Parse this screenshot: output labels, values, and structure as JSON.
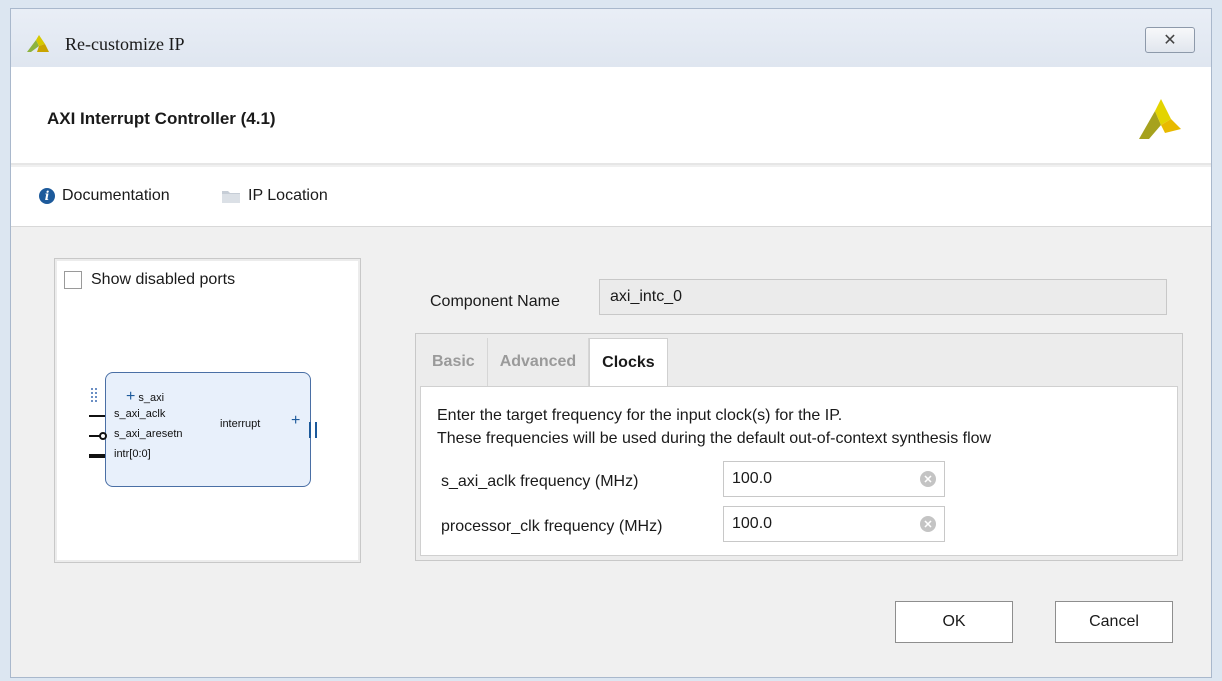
{
  "window": {
    "title": "Re-customize IP",
    "close_glyph": "✕"
  },
  "header": {
    "ip_title": "AXI Interrupt Controller (4.1)",
    "brand_logo_icon": "xilinx-logo-icon"
  },
  "links": {
    "documentation": {
      "label": "Documentation",
      "icon": "info-icon"
    },
    "ip_location": {
      "label": "IP Location",
      "icon": "folder-icon"
    }
  },
  "preview": {
    "show_disabled_ports": {
      "label": "Show disabled ports",
      "checked": false
    },
    "ports_left": [
      "s_axi",
      "s_axi_aclk",
      "s_axi_aresetn",
      "intr[0:0]"
    ],
    "port_right": "interrupt"
  },
  "form": {
    "component_name_label": "Component Name",
    "component_name_value": "axi_intc_0",
    "tabs": [
      {
        "label": "Basic",
        "active": false
      },
      {
        "label": "Advanced",
        "active": false
      },
      {
        "label": "Clocks",
        "active": true
      }
    ],
    "clocks": {
      "desc_line1": "Enter the target frequency for the input clock(s) for the IP.",
      "desc_line2": "These frequencies will be used during the default out-of-context synthesis flow",
      "fields": [
        {
          "label": "s_axi_aclk frequency (MHz)",
          "value": "100.0"
        },
        {
          "label": "processor_clk frequency (MHz)",
          "value": "100.0"
        }
      ]
    }
  },
  "buttons": {
    "ok": "OK",
    "cancel": "Cancel"
  },
  "colors": {
    "accent_green": "#8db33f",
    "brand_olive": "#a6a21e",
    "info_blue": "#1d5a9b"
  }
}
